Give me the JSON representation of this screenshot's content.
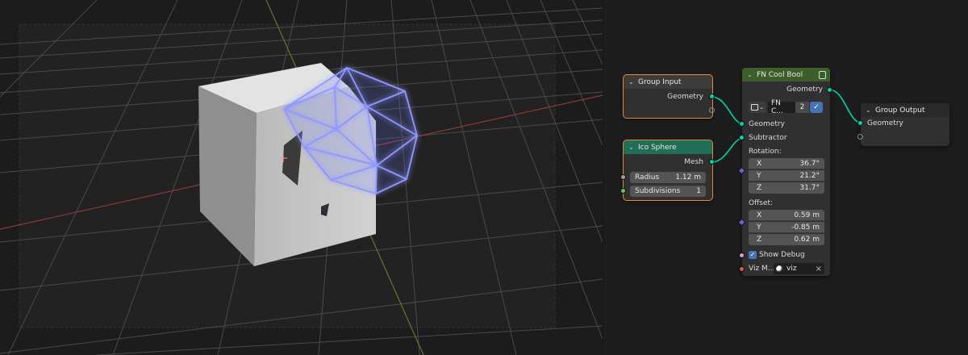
{
  "viewport": {
    "name": "3D Viewport"
  },
  "nodes": {
    "group_input": {
      "title": "Group Input",
      "outputs": [
        "Geometry"
      ]
    },
    "ico_sphere": {
      "title": "Ico Sphere",
      "output": "Mesh",
      "radius_label": "Radius",
      "radius_value": "1.12 m",
      "subdiv_label": "Subdivisions",
      "subdiv_value": "1"
    },
    "fn_cool_bool": {
      "title": "FN Cool Bool",
      "output": "Geometry",
      "group_name": "FN C...",
      "user_count": "2",
      "inputs": {
        "geometry": "Geometry",
        "subtractor": "Subtractor",
        "rotation_label": "Rotation:",
        "rotation": [
          {
            "axis": "X",
            "value": "36.7°"
          },
          {
            "axis": "Y",
            "value": "21.2°"
          },
          {
            "axis": "Z",
            "value": "31.7°"
          }
        ],
        "offset_label": "Offset:",
        "offset": [
          {
            "axis": "X",
            "value": "0.59 m"
          },
          {
            "axis": "Y",
            "value": "-0.85 m"
          },
          {
            "axis": "Z",
            "value": "0.62 m"
          }
        ],
        "show_debug": "Show Debug",
        "show_debug_checked": true,
        "viz_label": "Viz M...",
        "viz_value": "viz"
      }
    },
    "group_output": {
      "title": "Group Output",
      "input": "Geometry"
    }
  },
  "colors": {
    "geometry_socket": "#00d6a3",
    "group_header": "#3c3c3c",
    "mesh_primitive_header": "#1f6e55",
    "custom_group_header": "#3b5e2b",
    "selection_outline": "#e08a3a",
    "wireframe": "#8f98ff"
  },
  "icons": {
    "collapse": "chevron-down-icon",
    "node_group": "node-group-icon",
    "fake_user": "shield-icon",
    "material": "material-sphere-icon",
    "clear": "close-icon"
  }
}
